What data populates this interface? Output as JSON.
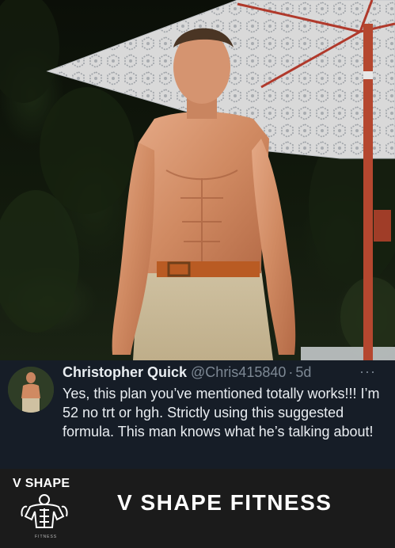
{
  "photo": {
    "description_icon": "shirtless-man-under-umbrella-photo"
  },
  "tweet": {
    "avatar_icon": "profile-avatar",
    "display_name": "Christopher Quick",
    "handle": "@Chris415840",
    "separator": "·",
    "time": "5d",
    "more_label": "···",
    "text": "Yes, this plan you’ve mentioned totally works!!! I’m 52 no trt or hgh. Strictly using this suggested formula. This man knows what he’s talking about!"
  },
  "footer": {
    "logo_title": "V SHAPE",
    "logo_subtitle": "FITNESS",
    "brand_name": "V SHAPE FITNESS",
    "logo_icon": "muscle-figure-logo-icon"
  },
  "colors": {
    "tweet_background": "#161d27",
    "footer_background": "#1b1b1b",
    "text_primary": "#e9edf1",
    "text_secondary": "#7d8894"
  }
}
